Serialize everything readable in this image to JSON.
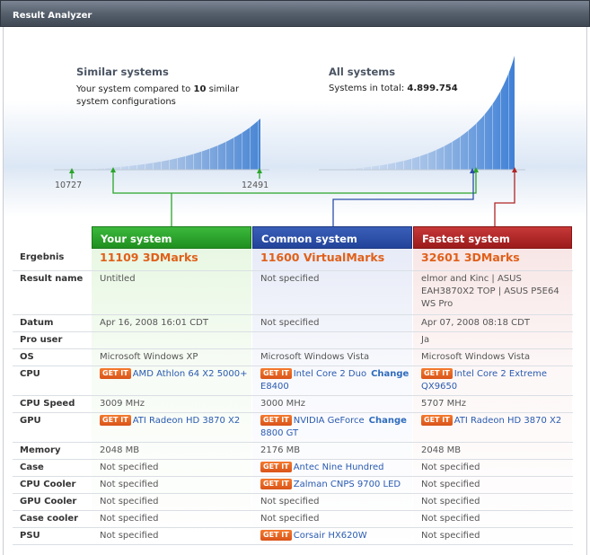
{
  "window": {
    "title": "Result Analyzer"
  },
  "similar": {
    "heading": "Similar systems",
    "text_prefix": "Your system compared to ",
    "text_count": "10",
    "text_suffix": " similar system configurations",
    "min_label": "10727",
    "max_label": "12491"
  },
  "all": {
    "heading": "All systems",
    "text_prefix": "Systems in total: ",
    "text_total": "4.899.754"
  },
  "columns": [
    "Your system",
    "Common system",
    "Fastest system"
  ],
  "get_it_label": "GET IT",
  "change_label": "Change",
  "rows": {
    "ergebnis": {
      "label": "Ergebnis",
      "c1": "11109 3DMarks",
      "c2": "11600 VirtualMarks",
      "c3": "32601 3DMarks"
    },
    "resultname": {
      "label": "Result name",
      "c1": "Untitled",
      "c2": "Not specified",
      "c3": "elmor and Kinc | ASUS EAH3870X2 TOP | ASUS P5E64 WS Pro"
    },
    "datum": {
      "label": "Datum",
      "c1": "Apr 16, 2008 16:01 CDT",
      "c2": "Not specified",
      "c3": "Apr 07, 2008 08:18 CDT"
    },
    "prouser": {
      "label": "Pro user",
      "c1": "",
      "c2": "",
      "c3": "Ja"
    },
    "os": {
      "label": "OS",
      "c1": "Microsoft Windows XP",
      "c2": "Microsoft Windows Vista",
      "c3": "Microsoft Windows Vista"
    },
    "cpu": {
      "label": "CPU",
      "c1": "AMD Athlon 64 X2 5000+",
      "c2": "Intel Core 2 Duo",
      "c2b": "E8400",
      "c3": "Intel Core 2 Extreme QX9650"
    },
    "cpuspeed": {
      "label": "CPU Speed",
      "c1": "3009 MHz",
      "c2": "3000 MHz",
      "c3": "5707 MHz"
    },
    "gpu": {
      "label": "GPU",
      "c1": "ATI Radeon HD 3870 X2",
      "c2": "NVIDIA GeForce",
      "c2b": "8800 GT",
      "c3": "ATI Radeon HD 3870 X2"
    },
    "memory": {
      "label": "Memory",
      "c1": "2048 MB",
      "c2": "2176 MB",
      "c3": "2048 MB"
    },
    "case": {
      "label": "Case",
      "c1": "Not specified",
      "c2": "Antec Nine Hundred",
      "c3": "Not specified"
    },
    "cpucooler": {
      "label": "CPU Cooler",
      "c1": "Not specified",
      "c2": "Zalman CNPS 9700 LED",
      "c3": "Not specified"
    },
    "gpucooler": {
      "label": "GPU Cooler",
      "c1": "Not specified",
      "c2": "Not specified",
      "c3": "Not specified"
    },
    "casecooler": {
      "label": "Case cooler",
      "c1": "Not specified",
      "c2": "Not specified",
      "c3": "Not specified"
    },
    "psu": {
      "label": "PSU",
      "c1": "Not specified",
      "c2": "Corsair HX620W",
      "c3": "Not specified"
    }
  },
  "colors": {
    "green": "#2aa52a",
    "blue": "#2b4ea8",
    "red": "#b02525",
    "score": "#e0601a",
    "link": "#2a5bb0",
    "getit": "#e8641f"
  }
}
